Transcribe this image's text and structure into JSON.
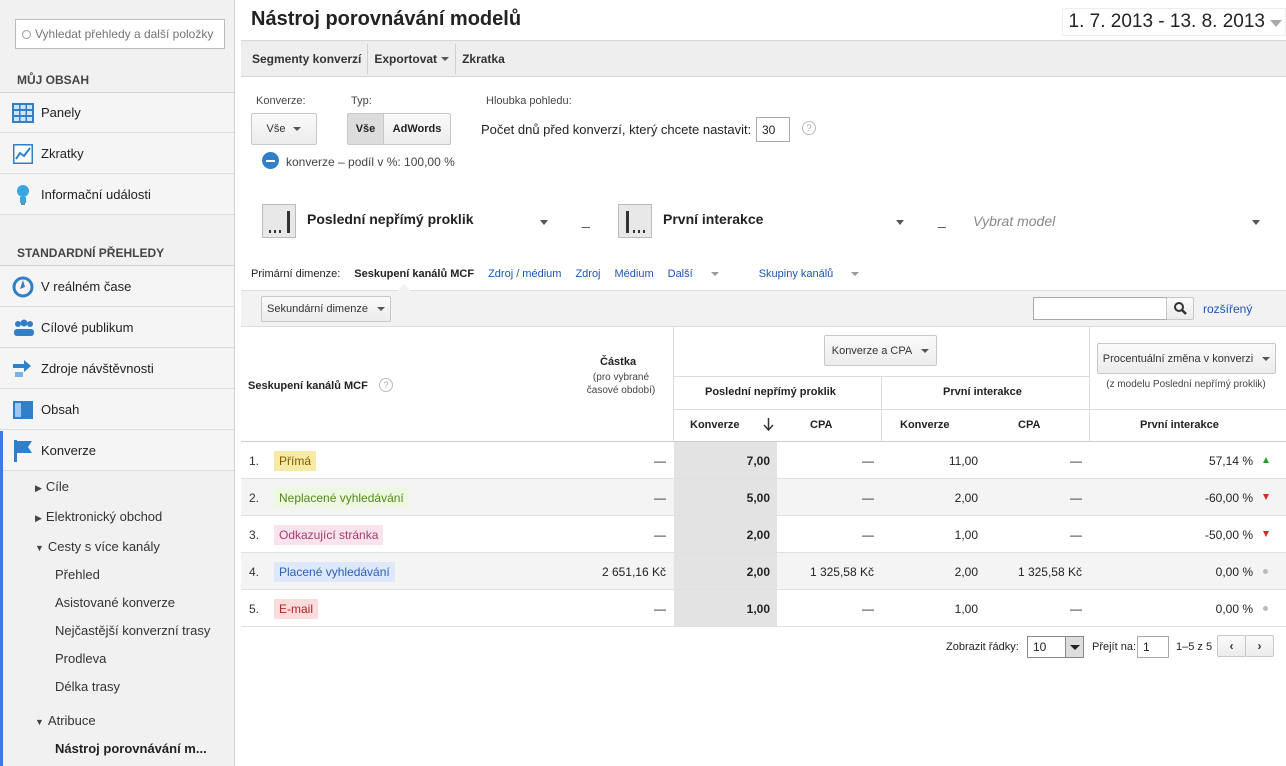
{
  "sidebar": {
    "search_placeholder": "Vyhledat přehledy a další položky",
    "section_my": "MŮJ OBSAH",
    "my_items": [
      "Panely",
      "Zkratky",
      "Informační události"
    ],
    "section_std": "STANDARDNÍ PŘEHLEDY",
    "std_items": [
      "V reálném čase",
      "Cílové publikum",
      "Zdroje návštěvnosti",
      "Obsah",
      "Konverze"
    ],
    "sub_items": [
      "Cíle",
      "Elektronický obchod",
      "Cesty s více kanály",
      "Přehled",
      "Asistované konverze",
      "Nejčastější konverzní trasy",
      "Prodleva",
      "Délka trasy",
      "Atribuce",
      "Nástroj porovnávání m..."
    ]
  },
  "header": {
    "title": "Nástroj porovnávání modelů",
    "date_range": "1. 7. 2013 - 13. 8. 2013"
  },
  "toolbar": {
    "segments": "Segmenty konverzí",
    "export": "Exportovat",
    "shortcut": "Zkratka"
  },
  "controls": {
    "conversion_label": "Konverze:",
    "conversion_value": "Vše",
    "type_label": "Typ:",
    "type_all": "Vše",
    "type_adwords": "AdWords",
    "depth_label": "Hloubka pohledu:",
    "days_label": "Počet dnů před konverzí, který chcete nastavit:",
    "days_value": "30",
    "legend": "konverze – podíl v %: 100,00 %"
  },
  "models": {
    "model1": "Poslední nepřímý proklik",
    "model2": "První interakce",
    "model3_placeholder": "Vybrat model",
    "sep": "_"
  },
  "dimensions": {
    "primary_label": "Primární dimenze:",
    "active": "Seskupení kanálů MCF",
    "links": [
      "Zdroj / médium",
      "Zdroj",
      "Médium",
      "Další",
      "Skupiny kanálů"
    ],
    "secondary": "Sekundární dimenze",
    "advanced": "rozšířený"
  },
  "table": {
    "col_group": "Seskupení kanálů MCF",
    "col_amount": "Částka",
    "col_amount_sub": "(pro vybrané časové období)",
    "metric_select": "Konverze a CPA",
    "model1": "Poslední nepřímý proklik",
    "model2": "První interakce",
    "conv": "Konverze",
    "cpa": "CPA",
    "change_select": "Procentuální změna v konverzi",
    "change_sub": "(z modelu Poslední nepřímý proklik)",
    "change_model": "První interakce",
    "rows": [
      {
        "n": "1.",
        "name": "Přímá",
        "amount": "—",
        "conv1": "7,00",
        "cpa1": "—",
        "conv2": "11,00",
        "cpa2": "—",
        "change": "57,14 %",
        "trend": "up"
      },
      {
        "n": "2.",
        "name": "Neplacené vyhledávání",
        "amount": "—",
        "conv1": "5,00",
        "cpa1": "—",
        "conv2": "2,00",
        "cpa2": "—",
        "change": "-60,00 %",
        "trend": "down"
      },
      {
        "n": "3.",
        "name": "Odkazující stránka",
        "amount": "—",
        "conv1": "2,00",
        "cpa1": "—",
        "conv2": "1,00",
        "cpa2": "—",
        "change": "-50,00 %",
        "trend": "down"
      },
      {
        "n": "4.",
        "name": "Placené vyhledávání",
        "amount": "2 651,16 Kč",
        "conv1": "2,00",
        "cpa1": "1 325,58 Kč",
        "conv2": "2,00",
        "cpa2": "1 325,58 Kč",
        "change": "0,00 %",
        "trend": "flat"
      },
      {
        "n": "5.",
        "name": "E-mail",
        "amount": "—",
        "conv1": "1,00",
        "cpa1": "—",
        "conv2": "1,00",
        "cpa2": "—",
        "change": "0,00 %",
        "trend": "flat"
      }
    ],
    "chip_colors": [
      "#f7e9a6",
      "#eef8e0",
      "#fbe3ee",
      "#dde8fb",
      "#fadcdc"
    ],
    "chip_text_colors": [
      "#7a5a00",
      "#4f8a1e",
      "#a43c6b",
      "#2b5fb5",
      "#b52424"
    ]
  },
  "pager": {
    "rows_label": "Zobrazit řádky:",
    "rows_value": "10",
    "goto_label": "Přejít na:",
    "goto_value": "1",
    "range": "1–5 z 5"
  }
}
